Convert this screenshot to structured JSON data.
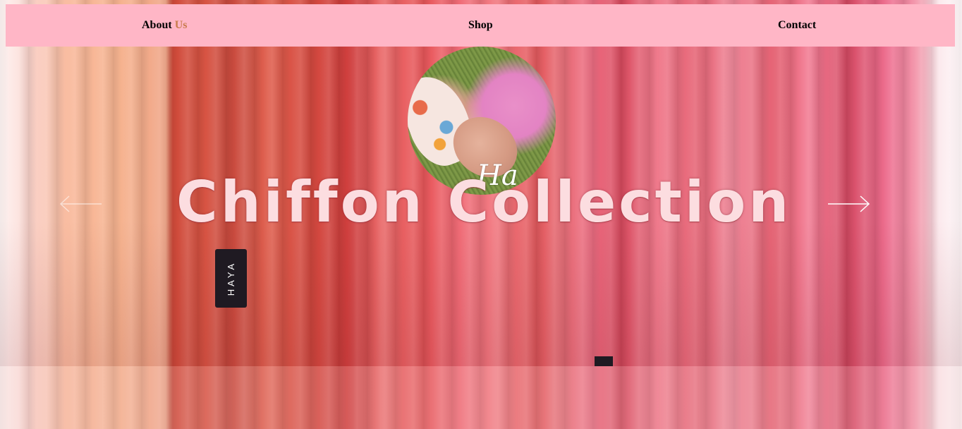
{
  "nav": {
    "about_main": "About",
    "about_accent": "Us",
    "shop": "Shop",
    "contact": "Contact"
  },
  "logo": {
    "text": "Ha"
  },
  "hero": {
    "title": "Chiffon Collection",
    "tag_text": "HAYA"
  },
  "icons": {
    "prev": "arrow-left-icon",
    "next": "arrow-right-icon"
  },
  "colors": {
    "nav_background": "#ffb6c6",
    "accent": "#c97c4e",
    "title": "#fcdde0"
  }
}
